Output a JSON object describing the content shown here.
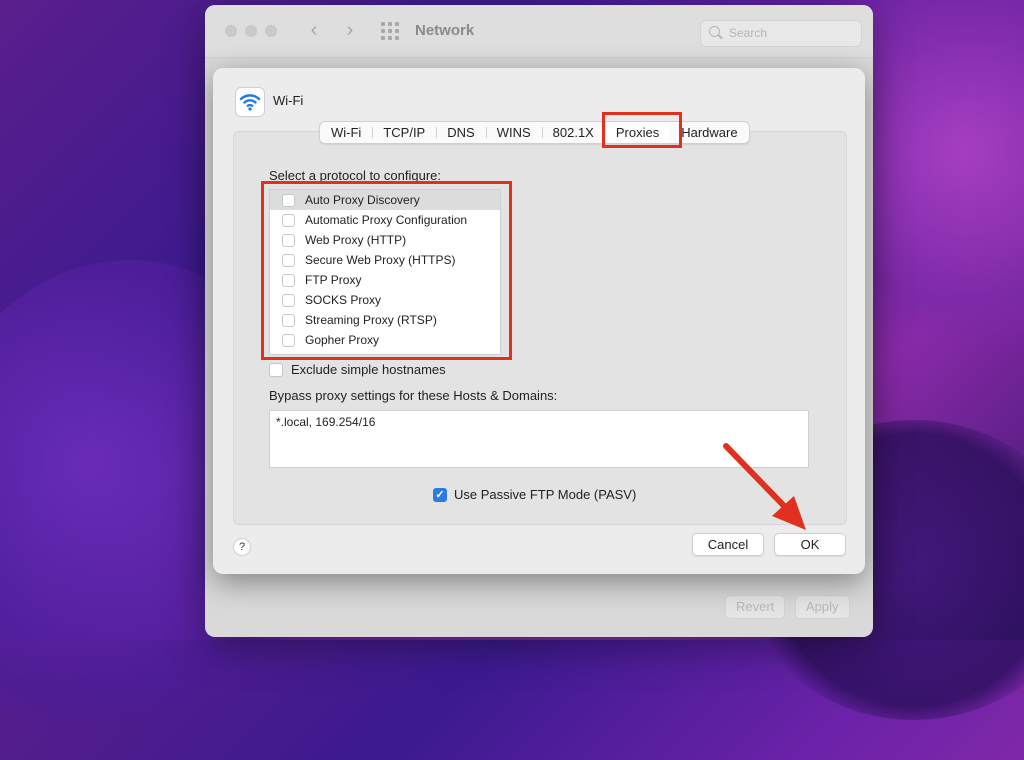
{
  "window": {
    "title": "Network",
    "search_placeholder": "Search"
  },
  "background_buttons": {
    "revert": "Revert",
    "apply": "Apply"
  },
  "sheet": {
    "service": "Wi-Fi",
    "tabs": [
      "Wi-Fi",
      "TCP/IP",
      "DNS",
      "WINS",
      "802.1X",
      "Proxies",
      "Hardware"
    ],
    "selected_tab": "Proxies",
    "select_label": "Select a protocol to configure:",
    "protocols": [
      {
        "label": "Auto Proxy Discovery",
        "checked": false,
        "selected": true
      },
      {
        "label": "Automatic Proxy Configuration",
        "checked": false
      },
      {
        "label": "Web Proxy (HTTP)",
        "checked": false
      },
      {
        "label": "Secure Web Proxy (HTTPS)",
        "checked": false
      },
      {
        "label": "FTP Proxy",
        "checked": false
      },
      {
        "label": "SOCKS Proxy",
        "checked": false
      },
      {
        "label": "Streaming Proxy (RTSP)",
        "checked": false
      },
      {
        "label": "Gopher Proxy",
        "checked": false
      }
    ],
    "exclude_label": "Exclude simple hostnames",
    "exclude_checked": false,
    "bypass_label": "Bypass proxy settings for these Hosts & Domains:",
    "bypass_value": "*.local, 169.254/16",
    "pasv_label": "Use Passive FTP Mode (PASV)",
    "pasv_checked": true,
    "help": "?",
    "cancel": "Cancel",
    "ok": "OK"
  },
  "colors": {
    "highlight": "#e0301e",
    "accent": "#2a7be4"
  }
}
